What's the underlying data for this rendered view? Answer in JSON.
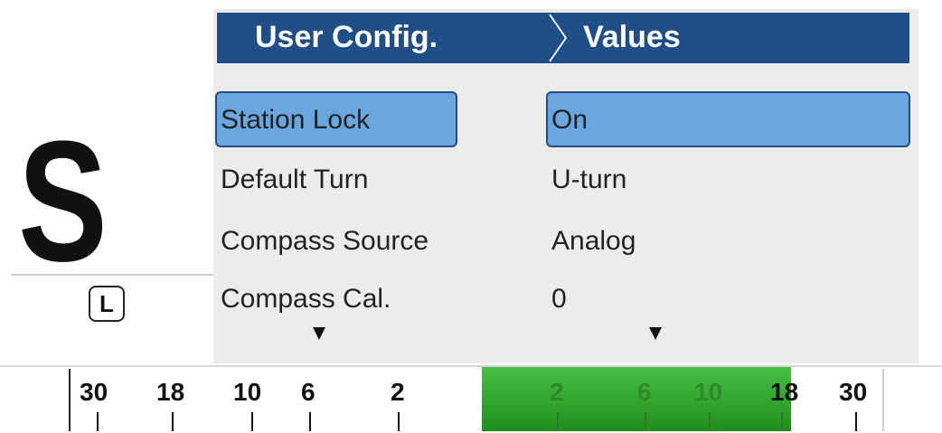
{
  "mode": {
    "letter": "S",
    "side_badge": "L"
  },
  "menu": {
    "title": "User Config.",
    "values_title": "Values",
    "rows": [
      {
        "label": "Station Lock",
        "value": "On",
        "selected": true
      },
      {
        "label": "Default Turn",
        "value": "U-turn",
        "selected": false
      },
      {
        "label": "Compass Source",
        "value": "Analog",
        "selected": false
      },
      {
        "label": "Compass Cal.",
        "value": "0",
        "selected": false
      }
    ],
    "scroll_icon": "down-arrow-icon"
  },
  "scale": {
    "left_labels": [
      "30",
      "18",
      "10",
      "6",
      "2"
    ],
    "right_labels": [
      "2",
      "6",
      "10",
      "18",
      "30"
    ]
  },
  "colors": {
    "header": "#1f4f86",
    "selection": "#6aa6df",
    "indicator": "#2e9e2a"
  }
}
